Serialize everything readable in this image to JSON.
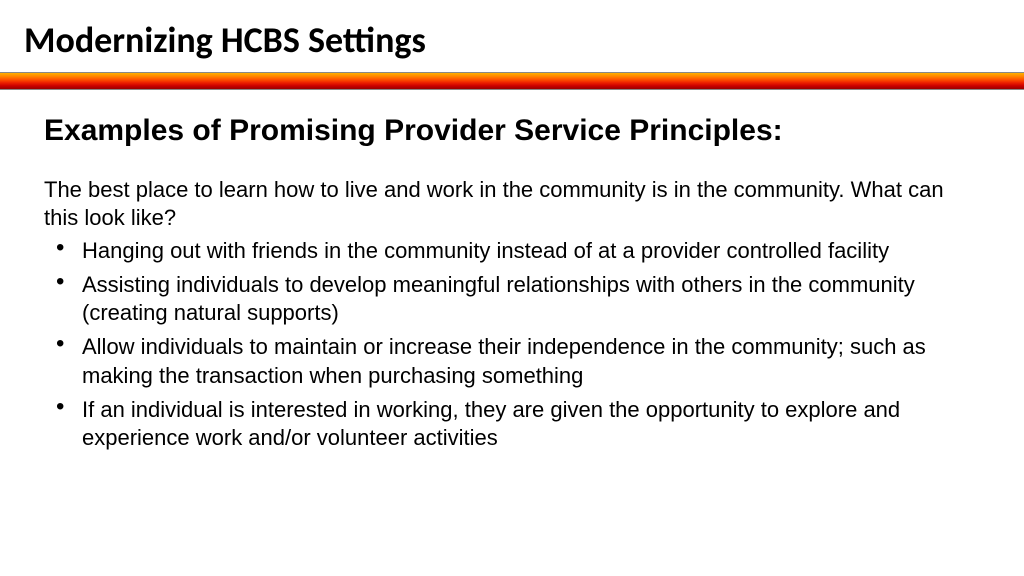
{
  "slide": {
    "title": "Modernizing HCBS Settings",
    "subheading": "Examples of Promising Provider Service Principles:",
    "intro": "The best place to learn how to live and work in the community is in the community. What can this look like?",
    "bullets": [
      "Hanging out with friends in the community instead of at a provider controlled facility",
      "Assisting individuals to develop meaningful relationships with others in the community (creating natural supports)",
      "Allow individuals to maintain or increase their independence in the community; such as making the transaction when purchasing something",
      "If an individual is interested in working, they are given the opportunity to explore and experience work and/or volunteer activities"
    ]
  }
}
